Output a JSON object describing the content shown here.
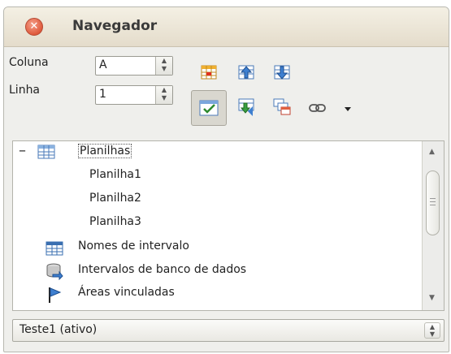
{
  "window": {
    "title": "Navegador"
  },
  "controls": {
    "column_label": "Coluna",
    "column_value": "A",
    "row_label": "Linha",
    "row_value": "1"
  },
  "toolbar": {
    "buttons": [
      "data-range-icon",
      "start-icon",
      "end-icon",
      "toggle-icon",
      "dragmode-icon",
      "scenarios-icon",
      "link-icon",
      "dropdown-icon"
    ]
  },
  "tree": {
    "collapse_symbol": "–",
    "root_label": "Planilhas",
    "sheets": [
      "Planilha1",
      "Planilha2",
      "Planilha3"
    ],
    "categories": [
      "Nomes de intervalo",
      "Intervalos de banco de dados",
      "Áreas vinculadas"
    ]
  },
  "document_select": {
    "value": "Teste1 (ativo)"
  },
  "colors": {
    "title_bg": "#ebe5d6",
    "close_red": "#df5a3c",
    "panel_bg": "#efefec"
  }
}
